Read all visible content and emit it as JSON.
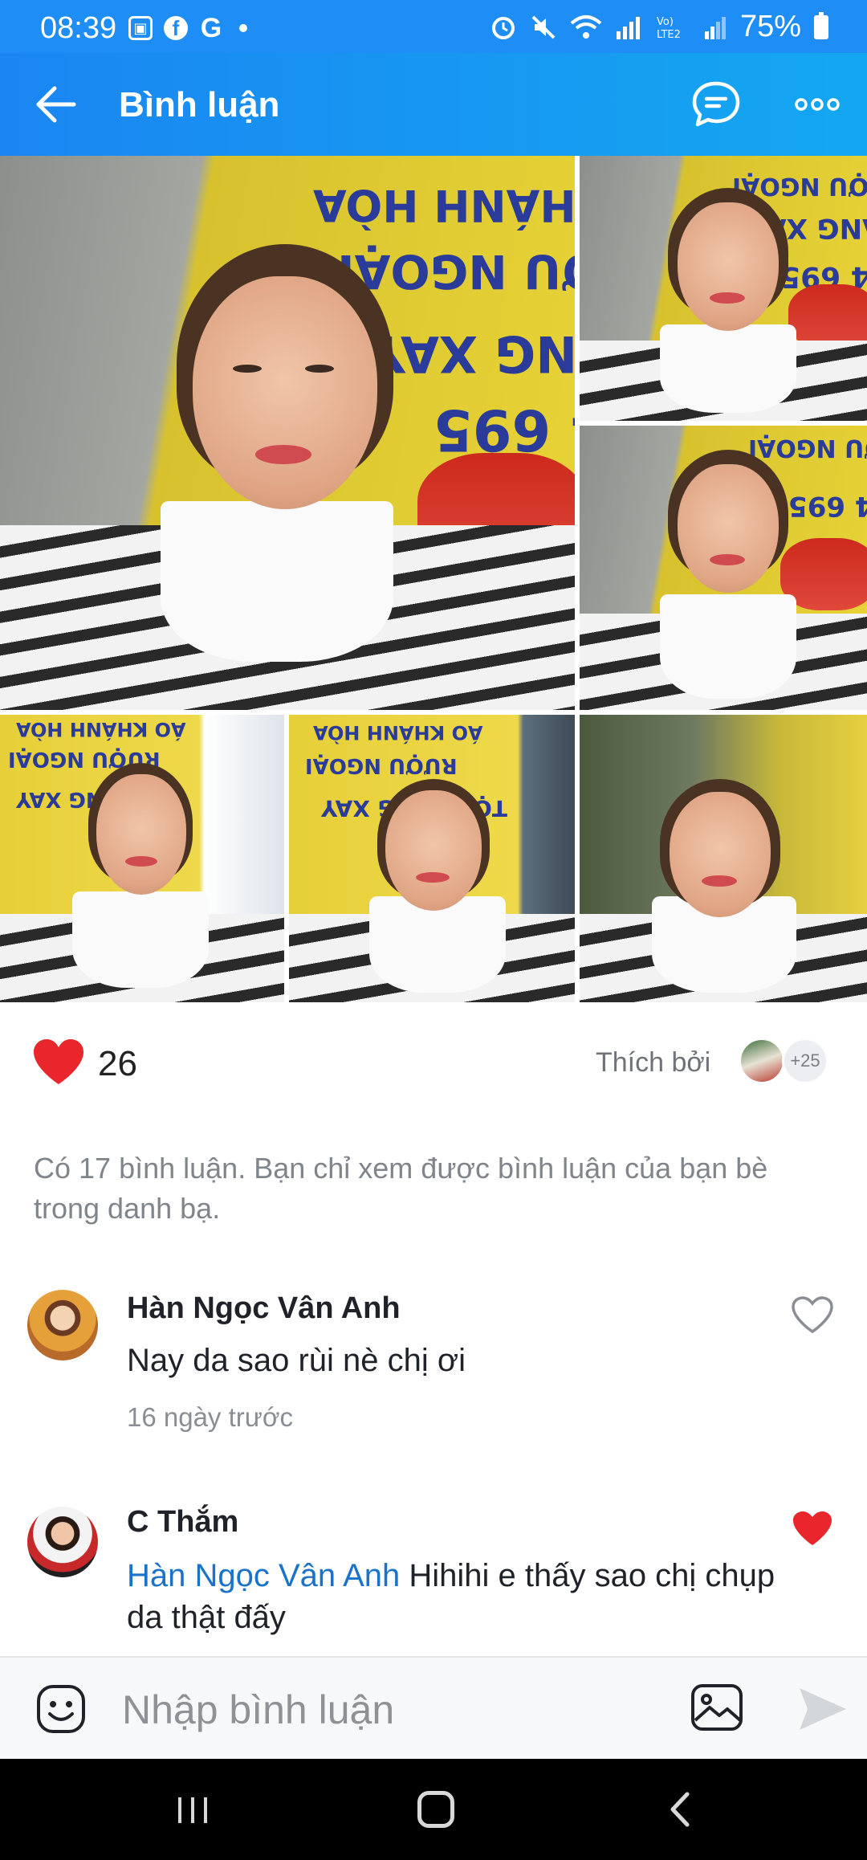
{
  "status_bar": {
    "time": "08:39",
    "battery": "75%",
    "left_icons": [
      "gallery-icon",
      "facebook-icon",
      "google-icon",
      "dot-icon"
    ],
    "right_icons": [
      "alarm-icon",
      "mute-icon",
      "wifi-icon",
      "volte-lte2-icon",
      "signal-icon",
      "signal-weak-icon",
      "battery-icon"
    ]
  },
  "header": {
    "title": "Bình luận",
    "accent": "#1a86f2"
  },
  "photos": {
    "count": 6,
    "sign_lines": [
      "ÁO KHÁNH HÒA",
      "RƯỢU NGOẠI",
      "TỘT RANG XAY",
      "4 695"
    ]
  },
  "likes": {
    "count": "26",
    "liked_by_label": "Thích bởi",
    "more_count": "+25",
    "heart_color": "#e8262b"
  },
  "notice": "Có 17 bình luận. Bạn chỉ xem được bình luận của bạn bè trong danh bạ.",
  "comments": [
    {
      "author": "Hàn Ngọc Vân Anh",
      "text": "Nay da sao rùi nè chị ơi",
      "time": "16 ngày trước",
      "liked": false
    },
    {
      "author": "C Thắm",
      "mention": "Hàn Ngọc Vân Anh",
      "text": " Hihihi e thấy sao chị chụp da thật đấy",
      "liked": true
    }
  ],
  "input": {
    "placeholder": "Nhập bình luận"
  }
}
